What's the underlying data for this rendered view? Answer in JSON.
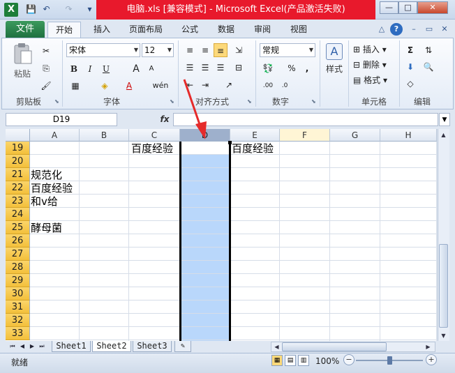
{
  "window": {
    "title": "电脑.xls  [兼容模式] - Microsoft Excel(产品激活失败)",
    "app_icon": "X",
    "controls": {
      "minimize": "—",
      "maximize": "□",
      "close": "✕"
    }
  },
  "quick_access": {
    "save": "💾",
    "undo": "↶",
    "redo": "↷",
    "customize": "▾"
  },
  "ribbon_tabs": {
    "file": "文件",
    "items": [
      "开始",
      "插入",
      "页面布局",
      "公式",
      "数据",
      "审阅",
      "视图"
    ]
  },
  "ribbon_tools": {
    "collapse": "△",
    "help": "?",
    "min": "–",
    "restore": "▭",
    "close": "✕"
  },
  "ribbon": {
    "clipboard": {
      "label": "剪贴板",
      "paste": "粘贴"
    },
    "font": {
      "label": "字体",
      "name": "宋体",
      "size": "12",
      "bold": "B",
      "italic": "I",
      "underline": "U",
      "grow": "A",
      "shrink": "A",
      "color_a": "A",
      "wen": "wén"
    },
    "alignment": {
      "label": "对齐方式"
    },
    "number": {
      "label": "数字",
      "format": "常规",
      "percent": "%",
      "comma": ",",
      "inc_dec": ".00",
      "dec_dec": ".0"
    },
    "styles": {
      "label": "",
      "styles_btn": "样式"
    },
    "cells": {
      "label": "单元格",
      "insert": "插入",
      "delete": "删除",
      "format": "格式"
    },
    "editing": {
      "label": "编辑",
      "sum": "Σ"
    }
  },
  "formula_bar": {
    "name_box": "D19",
    "fx": "fx",
    "content": ""
  },
  "grid": {
    "columns": [
      "A",
      "B",
      "C",
      "D",
      "E",
      "F",
      "G",
      "H"
    ],
    "selected_column": "D",
    "rows": [
      "19",
      "20",
      "21",
      "22",
      "23",
      "24",
      "25",
      "26",
      "27",
      "28",
      "29",
      "30",
      "31",
      "32",
      "33"
    ],
    "cells": {
      "C19": "百度经验",
      "E19": "百度经验",
      "A21": "规范化",
      "A22": "百度经验",
      "A23": "和v给",
      "A25": "酵母菌"
    }
  },
  "sheets": {
    "tabs": [
      "Sheet1",
      "Sheet2",
      "Sheet3"
    ],
    "active": "Sheet2",
    "nav": [
      "⏮",
      "◀",
      "▶",
      "⏭"
    ]
  },
  "status": {
    "ready": "就绪",
    "zoom": "100%",
    "zoom_value": 100
  },
  "colors": {
    "title_red": "#e8192c",
    "file_tab": "#1f7140",
    "row_header": "#f3c03b",
    "selection": "#b9d7fb"
  }
}
